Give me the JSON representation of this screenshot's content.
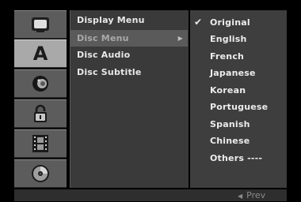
{
  "sidebar": {
    "tabs": [
      {
        "icon": "display-icon",
        "label": ""
      },
      {
        "icon": "language-icon",
        "label": "A",
        "active": true
      },
      {
        "icon": "speaker-icon",
        "label": ""
      },
      {
        "icon": "lock-icon",
        "label": ""
      },
      {
        "icon": "film-icon",
        "label": ""
      },
      {
        "icon": "disc-icon",
        "label": ""
      }
    ]
  },
  "menu": {
    "items": [
      {
        "label": "Display Menu"
      },
      {
        "label": "Disc Menu",
        "selected": true
      },
      {
        "label": "Disc Audio"
      },
      {
        "label": "Disc Subtitle"
      }
    ]
  },
  "options": {
    "items": [
      {
        "label": "Original",
        "checked": true
      },
      {
        "label": "English"
      },
      {
        "label": "French"
      },
      {
        "label": "Japanese"
      },
      {
        "label": "Korean"
      },
      {
        "label": "Portuguese"
      },
      {
        "label": "Spanish"
      },
      {
        "label": "Chinese"
      },
      {
        "label": "Others ----"
      }
    ]
  },
  "footer": {
    "prev_label": "Prev",
    "prev_glyph": "◀"
  },
  "colors": {
    "active_tab": "#a9a9a9",
    "inactive_tab": "#5c5c5c",
    "selected_menu_text": "#a9a9a9",
    "menu_bg": "#3a3a3a"
  }
}
